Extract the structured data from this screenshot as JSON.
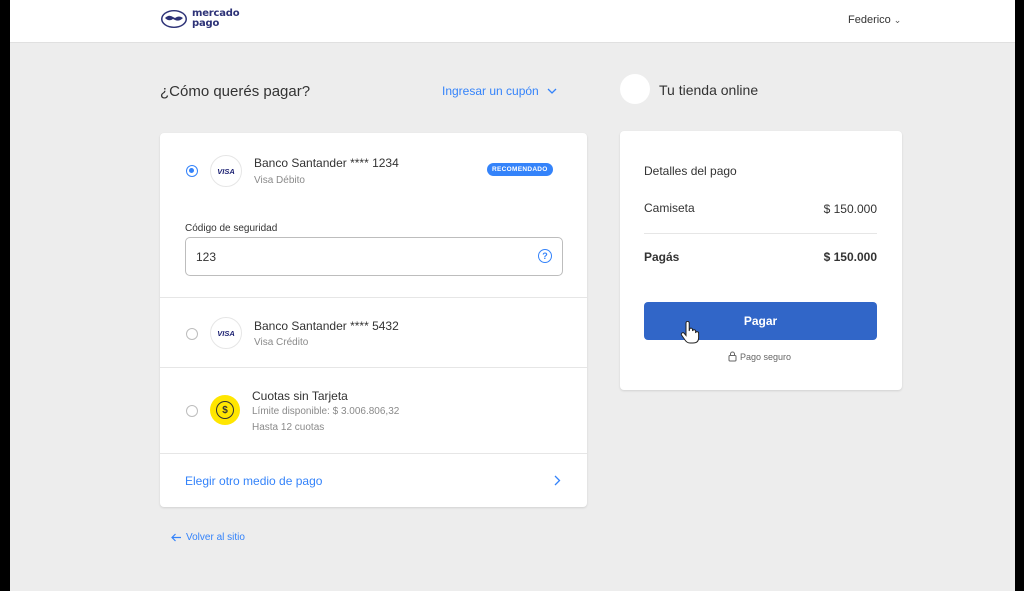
{
  "header": {
    "logo_text": "mercado pago",
    "user_name": "Federico"
  },
  "checkout": {
    "title": "¿Cómo querés pagar?",
    "coupon_link": "Ingresar un cupón"
  },
  "store": {
    "name": "Tu tienda online"
  },
  "methods": [
    {
      "brand": "VISA",
      "name": "Banco Santander **** 1234",
      "type": "Visa Débito",
      "badge": "RECOMENDADO",
      "selected": true
    },
    {
      "brand": "VISA",
      "name": "Banco Santander **** 5432",
      "type": "Visa Crédito",
      "selected": false
    },
    {
      "brand": "$",
      "name": "Cuotas sin Tarjeta",
      "type": "Límite disponible: $ 3.006.806,32",
      "extra": "Hasta 12 cuotas",
      "selected": false
    }
  ],
  "security": {
    "label": "Código de seguridad",
    "value": "123",
    "help_icon": "?"
  },
  "other_method_link": "Elegir otro medio de pago",
  "back_link": "Volver al sitio",
  "summary": {
    "title": "Detalles del pago",
    "item_name": "Camiseta",
    "item_price": "$ 150.000",
    "total_label": "Pagás",
    "total_price": "$ 150.000",
    "pay_button": "Pagar",
    "secure_text": "Pago seguro"
  },
  "colors": {
    "accent": "#3483fa",
    "pay_button": "#3166c8",
    "background": "#ededed",
    "coin": "#ffe600"
  },
  "icons": [
    "mercadopago-logo-icon",
    "chevron-down-icon",
    "question-icon",
    "chevron-right-icon",
    "arrow-left-icon",
    "lock-icon",
    "hand-cursor-icon",
    "dollar-coin-icon"
  ]
}
